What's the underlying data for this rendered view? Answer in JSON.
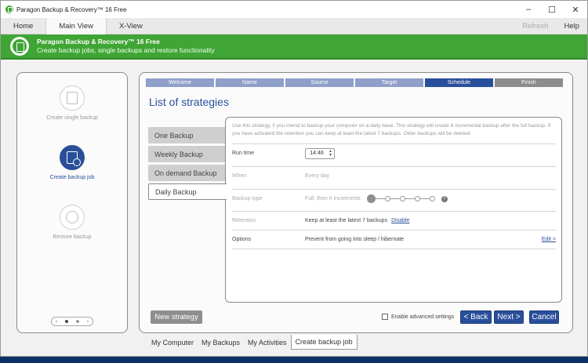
{
  "window": {
    "title": "Paragon Backup & Recovery™ 16 Free",
    "controls": {
      "minimize": "–",
      "maximize": "☐",
      "close": "✕"
    }
  },
  "ribbon": {
    "tabs": [
      "Home",
      "Main View",
      "X-View"
    ],
    "active_tab": "Main View",
    "refresh": "Refresh",
    "help": "Help"
  },
  "header": {
    "title": "Paragon Backup & Recovery™ 16 Free",
    "subtitle": "Create backup jobs, single backups and restore functionality"
  },
  "left_panel": {
    "items": [
      {
        "label": "Create single backup",
        "icon": "document-copy-icon",
        "active": false
      },
      {
        "label": "Create backup job",
        "icon": "scheduled-backup-icon",
        "active": true
      },
      {
        "label": "Restore backup",
        "icon": "restore-icon",
        "active": false
      }
    ],
    "pager": {
      "prev": "‹",
      "next": "›"
    }
  },
  "wizard": {
    "steps": [
      "Welcome",
      "Name",
      "Source",
      "Target",
      "Schedule",
      "Finish"
    ],
    "active_step": "Schedule",
    "title": "List of strategies"
  },
  "strategies": {
    "tabs": [
      "One Backup",
      "Weekly Backup",
      "On demand Backup",
      "Daily Backup"
    ],
    "selected": "Daily Backup",
    "description": "Use this strategy, if you intend to backup your computer on a daily base. This strategy will create 6 incremental backup after the full backup. If you have activated the retention you can keep at least the latest 7 backups. Older backups will be deleted.",
    "rows": {
      "run_time": {
        "label": "Run time",
        "value": "14:46"
      },
      "when": {
        "label": "When",
        "value": "Every day"
      },
      "backup_type": {
        "label": "Backup type",
        "value": "Full, then 6 increments",
        "help": "?"
      },
      "retention": {
        "label": "Retention",
        "value": "Keep at least the latest 7 backups",
        "link": "Disable"
      },
      "options": {
        "label": "Options",
        "value": "Prevent from going into sleep / hibernate",
        "link": "Edit >"
      }
    }
  },
  "footer": {
    "new_strategy": "New strategy",
    "advanced": "Enable advanced settings",
    "back": "< Back",
    "next": "Next >",
    "cancel": "Cancel"
  },
  "bottom_tabs": {
    "items": [
      "My Computer",
      "My Backups",
      "My Activities",
      "Create backup job"
    ],
    "active": "Create backup job"
  },
  "colors": {
    "brand_green": "#3fa535",
    "accent_blue": "#2a4f9a",
    "step_inactive": "#8f9fc9"
  }
}
